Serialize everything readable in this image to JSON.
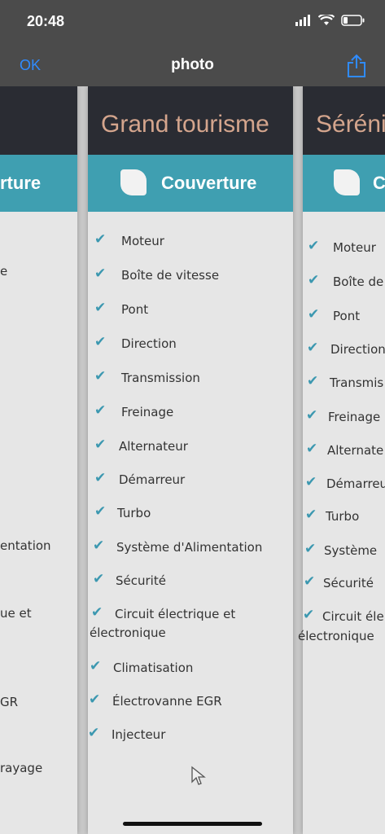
{
  "status": {
    "time": "20:48"
  },
  "nav": {
    "ok": "OK",
    "title": "photo"
  },
  "left_column": {
    "cover": "rture",
    "items": [
      "e",
      "entation",
      "ue et",
      "GR",
      "rayage"
    ]
  },
  "main_column": {
    "title": "Grand tourisme",
    "cover": "Couverture",
    "items": [
      "Moteur",
      "Boîte de vitesse",
      "Pont",
      "Direction",
      "Transmission",
      "Freinage",
      "Alternateur",
      "Démarreur",
      "Turbo",
      "Système d'Alimentation",
      "Sécurité",
      "Circuit électrique et",
      "électronique",
      "Climatisation",
      "Électrovanne EGR",
      "Injecteur"
    ]
  },
  "right_column": {
    "title": "Séréni",
    "cover": "C",
    "items": [
      "Moteur",
      "Boîte de",
      "Pont",
      "Direction",
      "Transmis",
      "Freinage",
      "Alternate",
      "Démarreu",
      "Turbo",
      "Système",
      "Sécurité",
      "Circuit éle",
      "électronique"
    ]
  },
  "colors": {
    "header": "#2a2c33",
    "accent": "#3f9fb1",
    "title": "#d4a58d",
    "nav_link": "#2f8bff"
  },
  "icons": [
    "signal-icon",
    "wifi-icon",
    "battery-icon",
    "share-icon",
    "leaf-icon",
    "check-icon",
    "cursor-icon"
  ]
}
